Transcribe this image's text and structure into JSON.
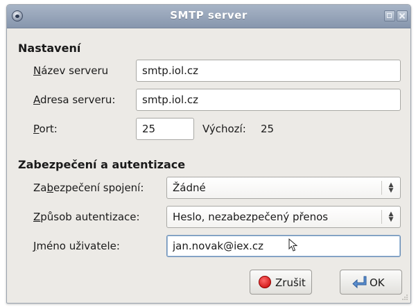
{
  "window": {
    "title": "SMTP server"
  },
  "settings": {
    "heading": "Nastavení",
    "server_name_label_accel": "N",
    "server_name_label_rest": "ázev serveru",
    "server_name_value": "smtp.iol.cz",
    "server_address_label_accel": "A",
    "server_address_label_rest": "dresa serveru:",
    "server_address_value": "smtp.iol.cz",
    "port_label_accel": "P",
    "port_label_rest": "ort:",
    "port_value": "25",
    "default_label": "Výchozí:",
    "default_value": "25"
  },
  "security": {
    "heading": "Zabezpečení a autentizace",
    "connection_label_pre": "Za",
    "connection_label_accel": "b",
    "connection_label_rest": "ezpečení spojení:",
    "connection_value": "Žádné",
    "auth_label_accel": "Z",
    "auth_label_rest": "působ autentizace:",
    "auth_value": "Heslo, nezabezpečený přenos",
    "username_label_accel": "J",
    "username_label_rest": "méno uživatele:",
    "username_value": "jan.novak@iex.cz"
  },
  "buttons": {
    "cancel_label": "Zrušit",
    "ok_label": "OK"
  },
  "icons": {
    "app": "app-icon",
    "maximize": "maximize-icon",
    "close": "close-icon",
    "cancel": "cancel-icon",
    "ok": "ok-icon",
    "cursor": "mouse-cursor-icon",
    "combo_arrows": "updown-arrows-icon"
  },
  "colors": {
    "titlebar": "#8f9db2",
    "window_bg": "#eceae6",
    "input_focus_border": "#6d8fb6",
    "cancel_icon": "#d40000"
  }
}
